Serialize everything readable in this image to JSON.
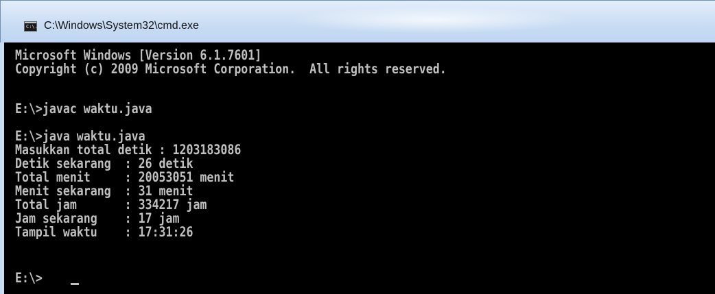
{
  "window": {
    "title": "C:\\Windows\\System32\\cmd.exe",
    "icon": "cmd-icon",
    "icon_text": "C:\\."
  },
  "console": {
    "lines": [
      "Microsoft Windows [Version 6.1.7601]",
      "Copyright (c) 2009 Microsoft Corporation.  All rights reserved.",
      "",
      "E:\\>javac waktu.java",
      "",
      "E:\\>java waktu.java",
      "Masukkan total detik : 1203183086",
      "Detik sekarang  : 26 detik",
      "Total menit     : 20053051 menit",
      "Menit sekarang  : 31 menit",
      "Total jam       : 334217 jam",
      "Jam sekarang    : 17 jam",
      "Tampil waktu    : 17:31:26",
      "",
      "E:\\>"
    ]
  },
  "colors": {
    "console_background": "#000000",
    "console_text": "#c0c0c0",
    "titlebar": "#c8dcf3"
  }
}
